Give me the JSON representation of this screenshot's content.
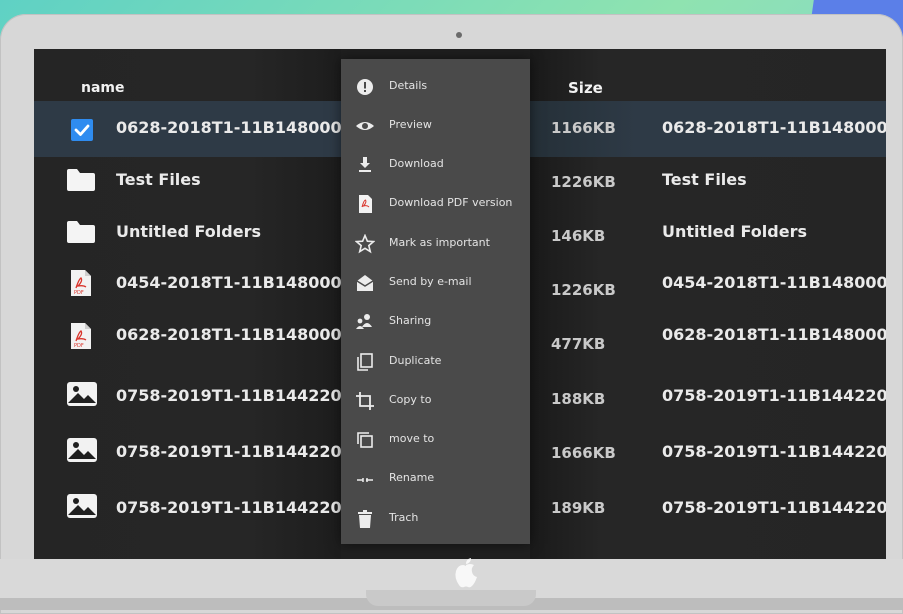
{
  "columns": {
    "name_header": "name",
    "size_header": "Size"
  },
  "files": [
    {
      "name": "0628-2018T1-11B148000",
      "size": "1166KB",
      "icon": "checkbox-checked-icon",
      "selected": true
    },
    {
      "name": "Test Files",
      "size": "1226KB",
      "icon": "folder-icon",
      "selected": false
    },
    {
      "name": "Untitled Folders",
      "size": "146KB",
      "icon": "folder-icon",
      "selected": false
    },
    {
      "name": "0454-2018T1-11B148000",
      "size": "1226KB",
      "icon": "pdf-file-icon",
      "selected": false
    },
    {
      "name": "0628-2018T1-11B148000",
      "size": "477KB",
      "icon": "pdf-file-icon",
      "selected": false
    },
    {
      "name": "0758-2019T1-11B144220",
      "size": "188KB",
      "icon": "image-file-icon",
      "selected": false
    },
    {
      "name": "0758-2019T1-11B144220",
      "size": "1666KB",
      "icon": "image-file-icon",
      "selected": false
    },
    {
      "name": "0758-2019T1-11B144220",
      "size": "189KB",
      "icon": "image-file-icon",
      "selected": false
    }
  ],
  "context_menu": [
    {
      "label": "Details",
      "icon": "info-icon"
    },
    {
      "label": "Preview",
      "icon": "eye-icon"
    },
    {
      "label": "Download",
      "icon": "download-icon"
    },
    {
      "label": "Download PDF version",
      "icon": "pdf-icon"
    },
    {
      "label": "Mark as important",
      "icon": "star-icon"
    },
    {
      "label": "Send by e-mail",
      "icon": "email-icon"
    },
    {
      "label": "Sharing",
      "icon": "people-icon"
    },
    {
      "label": "Duplicate",
      "icon": "duplicate-icon"
    },
    {
      "label": "Copy to",
      "icon": "crop-icon"
    },
    {
      "label": "move to",
      "icon": "move-icon"
    },
    {
      "label": "Rename",
      "icon": "rename-icon"
    },
    {
      "label": "Trach",
      "icon": "trash-icon"
    }
  ],
  "colors": {
    "screen_bg": "#1f1f1f",
    "menu_bg": "#4a4a4a",
    "selection": "#2e3a46",
    "checkbox": "#2f8cf0"
  }
}
